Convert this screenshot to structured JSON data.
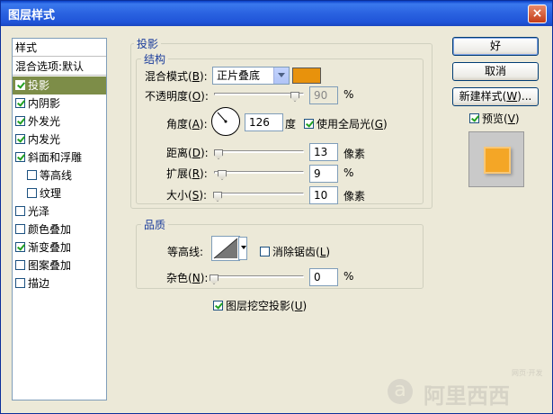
{
  "window": {
    "title": "图层样式",
    "close": "×"
  },
  "stylelist": {
    "header": "样式",
    "blend_options": "混合选项:默认",
    "items": [
      {
        "label": "投影",
        "checked": true,
        "selected": true
      },
      {
        "label": "内阴影",
        "checked": true
      },
      {
        "label": "外发光",
        "checked": true
      },
      {
        "label": "内发光",
        "checked": true
      },
      {
        "label": "斜面和浮雕",
        "checked": true
      },
      {
        "label": "等高线",
        "checked": false,
        "sub": true
      },
      {
        "label": "纹理",
        "checked": false,
        "sub": true
      },
      {
        "label": "光泽",
        "checked": false
      },
      {
        "label": "颜色叠加",
        "checked": false
      },
      {
        "label": "渐变叠加",
        "checked": true
      },
      {
        "label": "图案叠加",
        "checked": false
      },
      {
        "label": "描边",
        "checked": false
      }
    ]
  },
  "shadow": {
    "group_title": "投影",
    "structure_title": "结构",
    "blend_mode_label": "混合模式",
    "blend_mode_key": "B",
    "blend_mode_value": "正片叠底",
    "color": "#e8920c",
    "opacity_label": "不透明度",
    "opacity_key": "O",
    "opacity_value": "90",
    "opacity_unit": "%",
    "angle_label": "角度",
    "angle_key": "A",
    "angle_value": "126",
    "angle_unit": "度",
    "global_light_label": "使用全局光",
    "global_light_key": "G",
    "distance_label": "距离",
    "distance_key": "D",
    "distance_value": "13",
    "distance_unit": "像素",
    "spread_label": "扩展",
    "spread_key": "R",
    "spread_value": "9",
    "spread_unit": "%",
    "size_label": "大小",
    "size_key": "S",
    "size_value": "10",
    "size_unit": "像素",
    "opacity_level": 0.9,
    "distance_level": 0.05,
    "spread_level": 0.09,
    "size_level": 0.04
  },
  "quality": {
    "group_title": "品质",
    "contour_label": "等高线:",
    "antialias_label": "消除锯齿",
    "antialias_key": "L",
    "noise_label": "杂色",
    "noise_key": "N",
    "noise_value": "0",
    "noise_unit": "%",
    "knockout_label": "图层挖空投影",
    "knockout_key": "U"
  },
  "buttons": {
    "ok": "好",
    "cancel": "取消",
    "new_style": "新建样式",
    "new_style_key": "W",
    "preview_label": "预览",
    "preview_key": "V"
  },
  "watermark": {
    "logo": "a",
    "text": "阿里西西",
    "small": "网页·开发"
  }
}
